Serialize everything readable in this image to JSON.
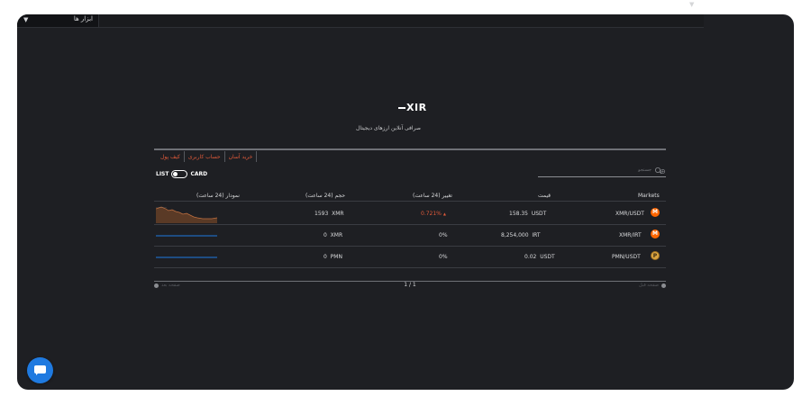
{
  "topbar": {
    "tools_label": "ابزار ها"
  },
  "brand": {
    "logo_text": "XIR",
    "subtitle": "صرافی آنلاین ارزهای دیجیتال"
  },
  "tabs": [
    {
      "label": "کیف پول"
    },
    {
      "label": "حساب کاربری"
    },
    {
      "label": "خرید آسان"
    }
  ],
  "view_toggle": {
    "left_label": "LIST",
    "right_label": "CARD"
  },
  "search": {
    "placeholder": "جستجو"
  },
  "table": {
    "headers": {
      "chart": "نمودار (24 ساعت)",
      "volume": "حجم (24 ساعت)",
      "change": "تغییر (24 ساعت)",
      "price": "قیمت",
      "markets": "Markets"
    },
    "rows": [
      {
        "market": "XMR/USDT",
        "coin": "xmr",
        "price": "158.35",
        "price_unit": "USDT",
        "change": "0.721%",
        "volume": "1593",
        "volume_unit": "XMR",
        "has_chart": true
      },
      {
        "market": "XMR/IRT",
        "coin": "xmr",
        "price": "8,254,000",
        "price_unit": "IRT",
        "change": "0%",
        "volume": "0",
        "volume_unit": "XMR",
        "has_chart": false
      },
      {
        "market": "PMN/USDT",
        "coin": "pmn",
        "price": "0.02",
        "price_unit": "USDT",
        "change": "0%",
        "volume": "0",
        "volume_unit": "PMN",
        "has_chart": false
      }
    ]
  },
  "pagination": {
    "prev_label": "صفحه بعد",
    "next_label": "صفحه قبل",
    "page": "1 / 1"
  },
  "colors": {
    "accent": "#e05a3a",
    "background": "#1e1f23",
    "line_chart": "#1f7ae0",
    "chat_button": "#1f7ae0"
  }
}
